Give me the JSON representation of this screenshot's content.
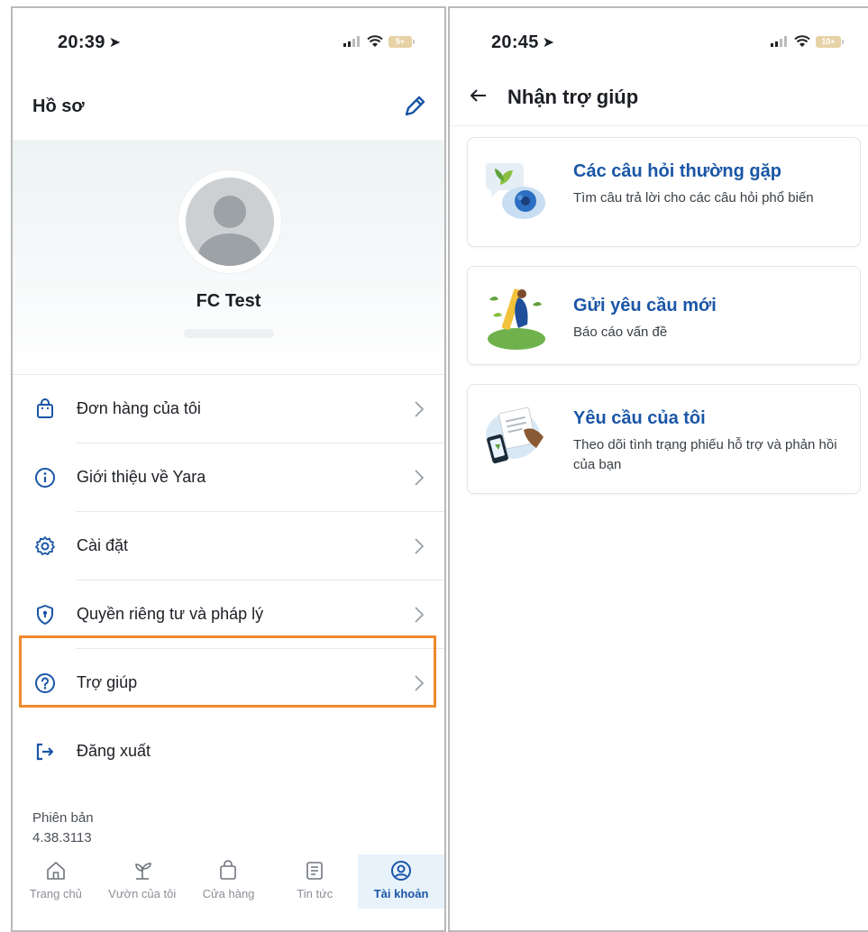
{
  "left_screen": {
    "status": {
      "time": "20:39",
      "battery": "5+"
    },
    "header": {
      "title": "Hồ sơ"
    },
    "profile": {
      "name": "FC Test"
    },
    "menu": [
      {
        "label": "Đơn hàng của tôi",
        "icon": "shopping-bag-icon"
      },
      {
        "label": "Giới thiệu về Yara",
        "icon": "info-icon"
      },
      {
        "label": "Cài đặt",
        "icon": "gear-icon"
      },
      {
        "label": "Quyền riêng tư và pháp lý",
        "icon": "shield-icon"
      },
      {
        "label": "Trợ giúp",
        "icon": "help-circle-icon",
        "highlighted": true
      },
      {
        "label": "Đăng xuất",
        "icon": "logout-icon"
      }
    ],
    "version": {
      "label": "Phiên bản",
      "number": "4.38.3113"
    },
    "tabbar": [
      {
        "label": "Trang chủ",
        "icon": "home-icon"
      },
      {
        "label": "Vườn của tôi",
        "icon": "plant-icon"
      },
      {
        "label": "Cửa hàng",
        "icon": "shopping-bag-icon"
      },
      {
        "label": "Tin tức",
        "icon": "news-icon"
      },
      {
        "label": "Tài khoản",
        "icon": "account-icon",
        "active": true
      }
    ]
  },
  "right_screen": {
    "status": {
      "time": "20:45",
      "battery": "10+"
    },
    "header": {
      "title": "Nhận trợ giúp"
    },
    "cards": [
      {
        "title": "Các câu hỏi thường gặp",
        "description": "Tìm câu trả lời cho các câu hỏi phổ biến",
        "icon": "faq-illustration"
      },
      {
        "title": "Gửi yêu cầu mới",
        "description": "Báo cáo vấn đề",
        "icon": "new-request-illustration"
      },
      {
        "title": "Yêu cầu của tôi",
        "description": "Theo dõi tình trạng phiếu hỗ trợ và phản hồi của bạn",
        "icon": "my-requests-illustration"
      }
    ]
  },
  "colors": {
    "brand_blue": "#1a56a6",
    "highlight_orange": "#f08a2e",
    "active_tab_bg": "#e8f2fb"
  }
}
